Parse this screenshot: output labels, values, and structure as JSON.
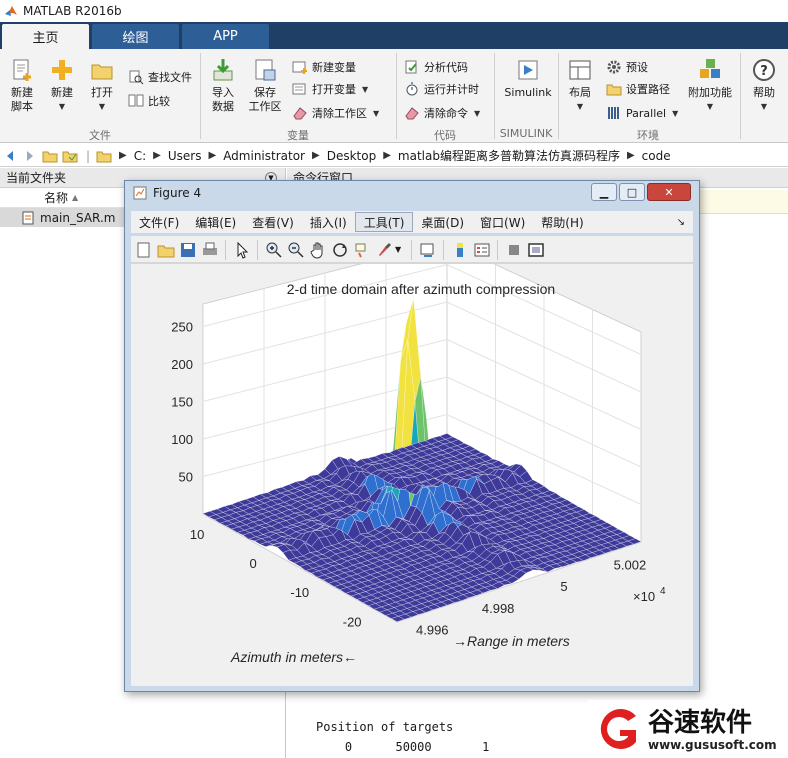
{
  "app": {
    "title": "MATLAB R2016b"
  },
  "tabs": [
    {
      "label": "主页"
    },
    {
      "label": "绘图"
    },
    {
      "label": "APP"
    }
  ],
  "ribbon": {
    "new_script": "新建\n脚本",
    "new": "新建",
    "open": "打开",
    "find_files": "查找文件",
    "compare": "比较",
    "import_data": "导入\n数据",
    "save_workspace": "保存\n工作区",
    "new_variable": "新建变量",
    "open_variable": "打开变量",
    "clear_workspace": "清除工作区",
    "analyze_code": "分析代码",
    "run_and_time": "运行并计时",
    "clear_commands": "清除命令",
    "simulink": "Simulink",
    "layout": "布局",
    "preferences": "预设",
    "set_path": "设置路径",
    "parallel": "Parallel",
    "addons": "附加功能",
    "help": "帮助",
    "groups": {
      "file": "文件",
      "variable": "变量",
      "code": "代码",
      "simulink": "SIMULINK",
      "environment": "环境"
    }
  },
  "address": {
    "segments": [
      "C:",
      "Users",
      "Administrator",
      "Desktop",
      "matlab编程距离多普勒算法仿真源码程序",
      "code"
    ]
  },
  "current_folder": {
    "title": "当前文件夹",
    "col_name": "名称",
    "files": [
      {
        "name": "main_SAR.m"
      }
    ]
  },
  "command_window": {
    "title": "命令行窗口",
    "line1": "Position of targets",
    "line2": "    0      50000       1"
  },
  "figure": {
    "title": "Figure 4",
    "menus": [
      "文件(F)",
      "编辑(E)",
      "查看(V)",
      "插入(I)",
      "工具(T)",
      "桌面(D)",
      "窗口(W)",
      "帮助(H)"
    ],
    "active_menu_index": 4,
    "plot_title": "2-d time domain after azimuth compression",
    "exponent_label": "×10",
    "exponent_power": "4"
  },
  "chart_data": {
    "type": "surface",
    "title": "2-d time domain after azimuth compression",
    "xlabel": "→Range in meters",
    "ylabel": "Azimuth in meters←",
    "x_ticks": [
      "4.996",
      "4.998",
      "5",
      "5.002"
    ],
    "x_multiplier": "×10^4",
    "y_ticks": [
      "10",
      "0",
      "-10",
      "-20"
    ],
    "z_ticks": [
      "50",
      "100",
      "150",
      "200",
      "250"
    ],
    "zlim": [
      0,
      280
    ],
    "peak": {
      "range": 50000,
      "azimuth": 0,
      "z": 265
    },
    "colormap": "parula",
    "grid": true
  },
  "watermark": {
    "brand": "谷速软件",
    "url": "www.gususoft.com"
  },
  "colors": {
    "ribbon_tab_bar": "#1f3f66",
    "surface_base": "#3a3a9a",
    "peak": "#f2e240",
    "watermark_red": "#e02020"
  }
}
